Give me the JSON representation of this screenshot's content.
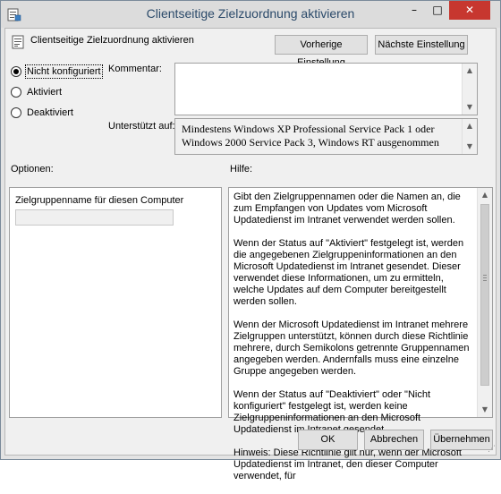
{
  "window": {
    "title": "Clientseitige Zielzuordnung aktivieren",
    "controls": {
      "minimize": "–",
      "maximize": "□",
      "close": "✕"
    },
    "app_icon": "group-policy-icon"
  },
  "policy": {
    "name": "Clientseitige Zielzuordnung aktivieren",
    "icon": "policy-setting-icon"
  },
  "nav": {
    "prev_label": "Vorherige Einstellung",
    "next_label": "Nächste Einstellung"
  },
  "state": {
    "options": [
      {
        "label": "Nicht konfiguriert",
        "checked": true
      },
      {
        "label": "Aktiviert",
        "checked": false
      },
      {
        "label": "Deaktiviert",
        "checked": false
      }
    ]
  },
  "comment": {
    "label": "Kommentar:",
    "value": ""
  },
  "supported": {
    "label": "Unterstützt auf:",
    "value": "Mindestens Windows XP Professional Service Pack 1 oder Windows 2000 Service Pack 3, Windows RT ausgenommen"
  },
  "options_panel": {
    "label": "Optionen:",
    "field_label": "Zielgruppenname für diesen Computer",
    "field_value": ""
  },
  "help_panel": {
    "label": "Hilfe:",
    "paragraphs": [
      "Gibt den Zielgruppennamen oder die Namen an, die zum Empfangen von Updates vom Microsoft Updatedienst im Intranet verwendet werden sollen.",
      "Wenn der Status auf \"Aktiviert\" festgelegt ist, werden die angegebenen Zielgruppeninformationen an den Microsoft Updatedienst im Intranet gesendet. Dieser verwendet diese Informationen, um zu ermitteln, welche Updates auf dem Computer bereitgestellt werden sollen.",
      "Wenn der Microsoft Updatedienst im Intranet mehrere Zielgruppen unterstützt, können durch diese Richtlinie mehrere, durch Semikolons getrennte Gruppennamen angegeben werden. Andernfalls muss eine einzelne Gruppe angegeben werden.",
      "Wenn der Status auf \"Deaktiviert\" oder \"Nicht konfiguriert\" festgelegt ist, werden keine Zielgruppeninformationen an den Microsoft Updatedienst im Intranet gesendet.",
      "Hinweis: Diese Richtlinie gilt nur, wenn der Microsoft Updatedienst im Intranet, den dieser Computer verwendet, für"
    ]
  },
  "footer": {
    "ok_label": "OK",
    "cancel_label": "Abbrechen",
    "apply_label": "Übernehmen"
  }
}
